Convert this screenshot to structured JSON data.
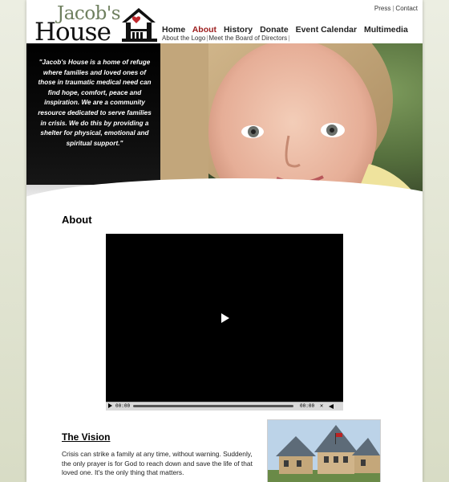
{
  "header": {
    "logo_line1": "Jacob's",
    "logo_line2": "House",
    "top_links": [
      "Press",
      "Contact"
    ]
  },
  "nav": {
    "items": [
      {
        "label": "Home",
        "active": false
      },
      {
        "label": "About",
        "active": true
      },
      {
        "label": "History",
        "active": false
      },
      {
        "label": "Donate",
        "active": false
      },
      {
        "label": "Event Calendar",
        "active": false
      },
      {
        "label": "Multimedia",
        "active": false
      }
    ],
    "sub_items": [
      "About the Logo",
      "Meet the Board of Directors"
    ]
  },
  "hero": {
    "quote": "\"Jacob's House is a home of refuge where families and loved ones of those in traumatic medical need can find hope, comfort, peace and inspiration. We are a community resource dedicated to serve families in crisis. We do this by providing a shelter for physical, emotional and spiritual support.\""
  },
  "main": {
    "title": "About",
    "video": {
      "time_elapsed": "00:00",
      "time_total": "00:00"
    },
    "vision": {
      "title": "The Vision",
      "text": "Crisis can strike a family at any time, without warning. Suddenly, the only prayer is for God to reach down and save the life of that loved one. It's the only thing that matters."
    }
  },
  "colors": {
    "accent_active": "#9b1b1b",
    "logo_green": "#6e7f5e",
    "background": "#e4e6d6"
  }
}
